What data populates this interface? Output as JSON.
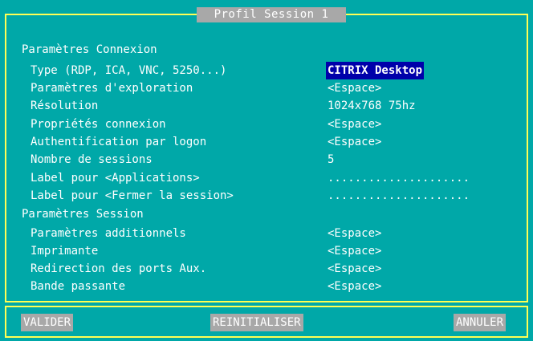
{
  "window": {
    "title": "Profil Session 1"
  },
  "sections": {
    "connexion": {
      "heading": "Paramètres Connexion",
      "rows": [
        {
          "label": "Type (RDP, ICA, VNC, 5250...)",
          "value": "CITRIX Desktop"
        },
        {
          "label": "Paramètres d'exploration",
          "value": "<Espace>"
        },
        {
          "label": "Résolution",
          "value": "1024x768 75hz"
        },
        {
          "label": "Propriétés connexion",
          "value": "<Espace>"
        },
        {
          "label": "Authentification par logon",
          "value": "<Espace>"
        },
        {
          "label": "Nombre de sessions",
          "value": "5"
        },
        {
          "label": "Label pour <Applications>",
          "value": "....................."
        },
        {
          "label": "Label pour <Fermer la session>",
          "value": "....................."
        }
      ]
    },
    "session": {
      "heading": "Paramètres Session",
      "rows": [
        {
          "label": "Paramètres additionnels",
          "value": "<Espace>"
        },
        {
          "label": "Imprimante",
          "value": "<Espace>"
        },
        {
          "label": "Redirection des ports Aux.",
          "value": "<Espace>"
        },
        {
          "label": "Bande passante",
          "value": "<Espace>"
        }
      ]
    }
  },
  "buttons": {
    "validate": "VALIDER",
    "reset": "REINITIALISER",
    "cancel": "ANNULER"
  },
  "colors": {
    "background": "#00a8a8",
    "frame": "#ffff54",
    "selected": "#0000aa",
    "button": "#a8a8a8"
  }
}
